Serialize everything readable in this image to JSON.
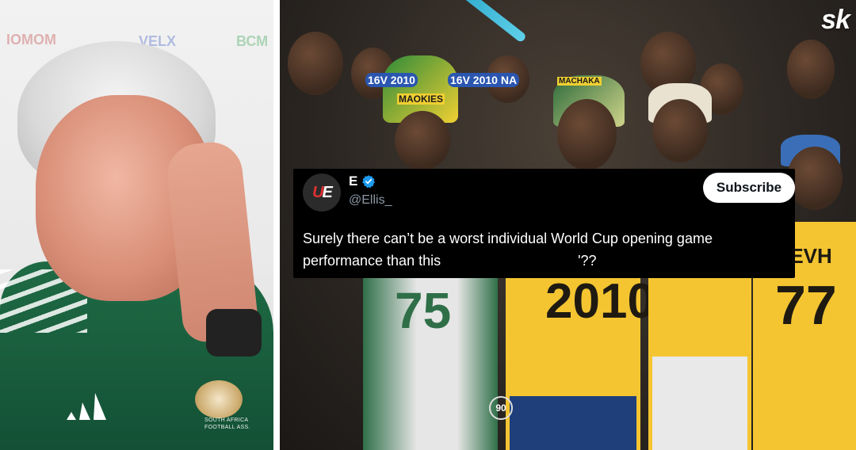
{
  "left_photo": {
    "sponsors": [
      "IOMOM",
      "VELX",
      "ВСМ"
    ],
    "badge_text": "SOUTH AFRICA\nFOOTBALL ASS."
  },
  "right_photo": {
    "watermark": "sk",
    "signs": [
      "16V 2010",
      "MAOKIES",
      "16V 2010 NA",
      "MACHAKA"
    ],
    "jersey_numbers": [
      "75",
      "2010",
      "77",
      "90"
    ],
    "jersey_text": "KWEVH"
  },
  "tweet": {
    "name": "E",
    "handle": "@Ellis_",
    "subscribe_label": "Subscribe",
    "text_before": "Surely there can’t be a worst individual World Cup opening game performance than this",
    "text_after": "'??"
  },
  "colors": {
    "shirt_green": "#1f6b45",
    "verified_blue": "#1d9bf0",
    "handle_gray": "#8b98a5",
    "jersey_yellow": "#f4c531"
  }
}
